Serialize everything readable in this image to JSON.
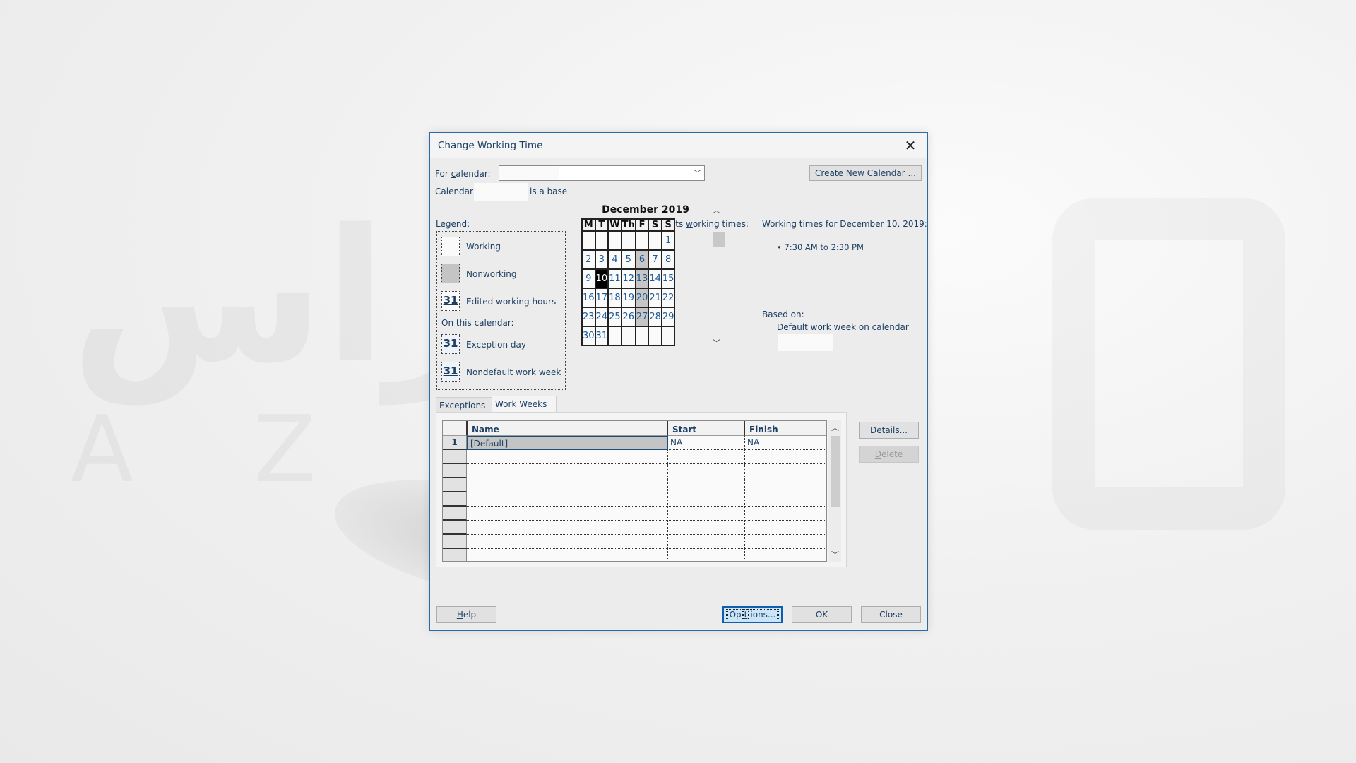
{
  "background": {
    "watermark_logo": "ازاس",
    "watermark_latin": "AZAS"
  },
  "dialog": {
    "title": "Change Working Time",
    "close_icon": "close-icon"
  },
  "header": {
    "for_calendar_label_pre": "For ",
    "for_calendar_label_u": "c",
    "for_calendar_label_post": "alendar:",
    "for_calendar_value": "",
    "calendar_text_pre": "Calendar",
    "calendar_text_post": "is a base",
    "create_new_calendar_pre": "Create ",
    "create_new_calendar_u": "N",
    "create_new_calendar_post": "ew Calendar ..."
  },
  "legend": {
    "title": "Legend:",
    "items": [
      {
        "label": "Working",
        "swatch": "white"
      },
      {
        "label": "Nonworking",
        "swatch": "gray"
      },
      {
        "label": "Edited working hours",
        "swatch": "31"
      }
    ],
    "on_this_calendar": "On this calendar:",
    "calendar_items": [
      {
        "label": "Exception day",
        "swatch": "31"
      },
      {
        "label": "Nondefault work week",
        "swatch": "31"
      }
    ]
  },
  "calendar": {
    "instruction_pre": "Click on a day to see its ",
    "instruction_u": "w",
    "instruction_post": "orking times:",
    "month_title": "December 2019",
    "weekdays": [
      "M",
      "T",
      "W",
      "Th",
      "F",
      "S",
      "S"
    ],
    "weeks": [
      [
        "",
        "",
        "",
        "",
        "",
        "",
        "1"
      ],
      [
        "2",
        "3",
        "4",
        "5",
        "6",
        "7",
        "8"
      ],
      [
        "9",
        "10",
        "11",
        "12",
        "13",
        "14",
        "15"
      ],
      [
        "16",
        "17",
        "18",
        "19",
        "20",
        "21",
        "22"
      ],
      [
        "23",
        "24",
        "25",
        "26",
        "27",
        "28",
        "29"
      ],
      [
        "30",
        "31",
        "",
        "",
        "",
        "",
        ""
      ]
    ],
    "nonworking_days": [
      "6",
      "13",
      "20",
      "27"
    ],
    "selected_day": "10"
  },
  "working_times": {
    "title": "Working times for December 10, 2019:",
    "times": [
      "• 7:30 AM to 2:30 PM"
    ],
    "based_on_label": "Based on:",
    "based_on_value": "Default work week on calendar"
  },
  "tabs": [
    {
      "label": "Exceptions",
      "active": false
    },
    {
      "label": "Work Weeks",
      "active": true
    }
  ],
  "work_weeks_table": {
    "columns": [
      "Name",
      "Start",
      "Finish"
    ],
    "rows": [
      {
        "num": "1",
        "name": "[Default]",
        "start": "NA",
        "finish": "NA"
      }
    ],
    "empty_rows": 8
  },
  "side_buttons": {
    "details_pre": "D",
    "details_u": "e",
    "details_post": "tails...",
    "delete_u": "D",
    "delete_post": "elete"
  },
  "footer": {
    "help_u": "H",
    "help_post": "elp",
    "options_pre": "Op",
    "options_u": "t",
    "options_post": "ions...",
    "ok": "OK",
    "close": "Close"
  }
}
